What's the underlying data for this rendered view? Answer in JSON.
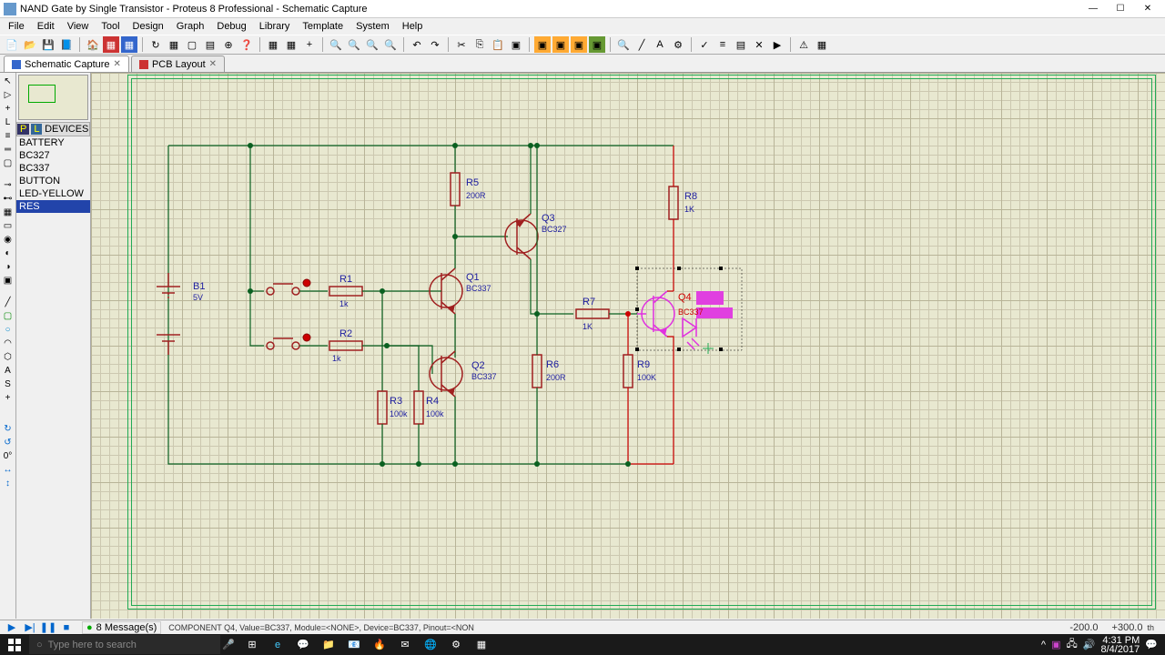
{
  "title": "NAND Gate by Single Transistor - Proteus 8 Professional - Schematic Capture",
  "menu": [
    "File",
    "Edit",
    "View",
    "Tool",
    "Design",
    "Graph",
    "Debug",
    "Library",
    "Template",
    "System",
    "Help"
  ],
  "tabs": [
    {
      "label": "Schematic Capture",
      "active": true
    },
    {
      "label": "PCB Layout",
      "active": false
    }
  ],
  "devices_header": "DEVICES",
  "devices": [
    "BATTERY",
    "BC327",
    "BC337",
    "BUTTON",
    "LED-YELLOW",
    "RES"
  ],
  "selected_device_index": 5,
  "components": {
    "B1": {
      "ref": "B1",
      "val": "5V"
    },
    "R1": {
      "ref": "R1",
      "val": "1k"
    },
    "R2": {
      "ref": "R2",
      "val": "1k"
    },
    "R3": {
      "ref": "R3",
      "val": "100k"
    },
    "R4": {
      "ref": "R4",
      "val": "100k"
    },
    "R5": {
      "ref": "R5",
      "val": "200R"
    },
    "R6": {
      "ref": "R6",
      "val": "200R"
    },
    "R7": {
      "ref": "R7",
      "val": "1K"
    },
    "R8": {
      "ref": "R8",
      "val": "1K"
    },
    "R9": {
      "ref": "R9",
      "val": "100K"
    },
    "Q1": {
      "ref": "Q1",
      "val": "BC337"
    },
    "Q2": {
      "ref": "Q2",
      "val": "BC337"
    },
    "Q3": {
      "ref": "Q3",
      "val": "BC327"
    },
    "Q4": {
      "ref": "Q4",
      "val": "BC337"
    }
  },
  "status": {
    "messages": "8 Message(s)",
    "info": "COMPONENT Q4, Value=BC337, Module=<NONE>, Device=BC337, Pinout=<NON",
    "coord1": "-200.0",
    "coord2": "+300.0"
  },
  "taskbar": {
    "search_placeholder": "Type here to search",
    "time": "4:31 PM",
    "date": "8/4/2017"
  }
}
